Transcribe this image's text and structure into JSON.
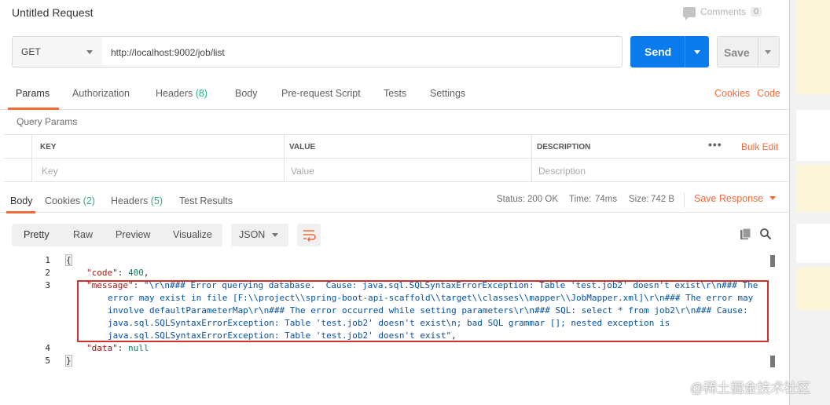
{
  "title": "Untitled Request",
  "comments": {
    "label": "Comments",
    "count": "0"
  },
  "request": {
    "method": "GET",
    "url": "http://localhost:9002/job/list",
    "send_label": "Send",
    "save_label": "Save"
  },
  "request_tabs": [
    {
      "label": "Params"
    },
    {
      "label": "Authorization"
    },
    {
      "label": "Headers",
      "count": "(8)"
    },
    {
      "label": "Body"
    },
    {
      "label": "Pre-request Script"
    },
    {
      "label": "Tests"
    },
    {
      "label": "Settings"
    }
  ],
  "request_links": {
    "cookies": "Cookies",
    "code": "Code"
  },
  "query_params": {
    "title": "Query Params",
    "headers": {
      "key": "KEY",
      "value": "VALUE",
      "description": "DESCRIPTION"
    },
    "placeholders": {
      "key": "Key",
      "value": "Value",
      "description": "Description"
    },
    "bulk_edit": "Bulk Edit",
    "more": "•••"
  },
  "response_tabs": [
    {
      "label": "Body"
    },
    {
      "label": "Cookies",
      "count": "(2)"
    },
    {
      "label": "Headers",
      "count": "(5)"
    },
    {
      "label": "Test Results"
    }
  ],
  "response_meta": {
    "status_label": "Status:",
    "status_value": "200 OK",
    "time_label": "Time:",
    "time_value": "74ms",
    "size_label": "Size:",
    "size_value": "742 B",
    "save_response": "Save Response"
  },
  "view_modes": [
    "Pretty",
    "Raw",
    "Preview",
    "Visualize"
  ],
  "format": "JSON",
  "code_lines": [
    {
      "n": "1",
      "text": "{"
    },
    {
      "n": "2",
      "key": "\"code\"",
      "sep": ": ",
      "val": "400",
      "tail": ","
    },
    {
      "n": "3",
      "key": "\"message\"",
      "sep": ": ",
      "val": "\"\\r\\n### Error querying database.  Cause: java.sql.SQLSyntaxErrorException: Table 'test.job2' doesn't exist\\r\\n### The"
    },
    {
      "n": "",
      "val": "error may exist in file [F:\\\\project\\\\spring-boot-api-scaffold\\\\target\\\\classes\\\\mapper\\\\JobMapper.xml]\\r\\n### The error may"
    },
    {
      "n": "",
      "val": "involve defaultParameterMap\\r\\n### The error occurred while setting parameters\\r\\n### SQL: select * from job2\\r\\n### Cause:"
    },
    {
      "n": "",
      "val": "java.sql.SQLSyntaxErrorException: Table 'test.job2' doesn't exist\\n; bad SQL grammar []; nested exception is"
    },
    {
      "n": "",
      "val": "java.sql.SQLSyntaxErrorException: Table 'test.job2' doesn't exist\"",
      "tail": ","
    },
    {
      "n": "4",
      "key": "\"data\"",
      "sep": ": ",
      "val": "null"
    },
    {
      "n": "5",
      "text": "}"
    }
  ],
  "watermark": "@稀土掘金技术社区",
  "colors": {
    "accent": "#f26b3a",
    "send": "#097bed",
    "ok": "#26b47f",
    "highlight_box": "#d0312d"
  }
}
